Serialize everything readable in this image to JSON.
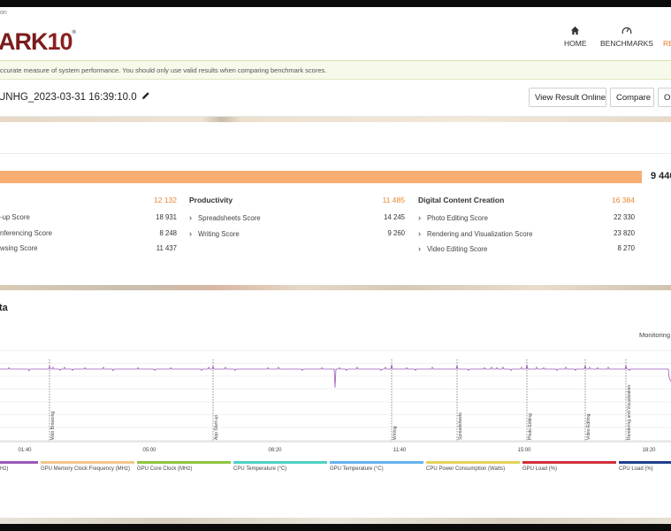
{
  "window": {
    "title_fragment": "on"
  },
  "header": {
    "logo_main": "ARK",
    "logo_num": "10",
    "logo_reg": "®",
    "nav": [
      {
        "label": "HOME",
        "icon": "home-icon"
      },
      {
        "label": "BENCHMARKS",
        "icon": "speedometer-icon"
      },
      {
        "label": "RE"
      }
    ]
  },
  "banner": {
    "text": "ccurate measure of system performance. You should only use valid results when comparing benchmark scores."
  },
  "result": {
    "name": "UNHG_2023-03-31 16:39:10.0",
    "buttons": {
      "view": "View Result Online",
      "compare": "Compare",
      "options": "Op"
    }
  },
  "scores": {
    "total": "9 440",
    "groups": [
      {
        "title": "",
        "value": "12 132",
        "rows": [
          {
            "label": "-up Score",
            "value": "18 931"
          },
          {
            "label": "nferencing Score",
            "value": "8 248"
          },
          {
            "label": "wsing Score",
            "value": "11 437"
          }
        ]
      },
      {
        "title": "Productivity",
        "value": "11 485",
        "rows": [
          {
            "label": "Spreadsheets Score",
            "value": "14 245"
          },
          {
            "label": "Writing Score",
            "value": "9 260"
          }
        ]
      },
      {
        "title": "Digital Content Creation",
        "value": "16 384",
        "rows": [
          {
            "label": "Photo Editing Score",
            "value": "22 330"
          },
          {
            "label": "Rendering and Visualization Score",
            "value": "23 820"
          },
          {
            "label": "Video Editing Score",
            "value": "8 270"
          }
        ]
      }
    ]
  },
  "monitoring": {
    "title": "ta",
    "right_label": "Monitoring",
    "time_ticks": [
      "01:40",
      "05:00",
      "08:20",
      "11:40",
      "15:00",
      "18:20"
    ],
    "markers": [
      "Web Browsing",
      "App Start-up",
      "Writing",
      "Spreadsheets",
      "Photo Editing",
      "Video Editing",
      "Rendering and Visualization"
    ],
    "legend": [
      {
        "label": "Hz)",
        "color": "#9b59b6"
      },
      {
        "label": "GPU Memory Clock Frequency (MHz)",
        "color": "#f2c68c"
      },
      {
        "label": "GPU Core Clock (MHz)",
        "color": "#8dc63f"
      },
      {
        "label": "CPU Temperature (°C)",
        "color": "#4fd1c5"
      },
      {
        "label": "GPU Temperature (°C)",
        "color": "#63b3ed"
      },
      {
        "label": "CPU Power Consumption (Watts)",
        "color": "#e4d35c"
      },
      {
        "label": "GPU Load (%)",
        "color": "#d32f3a"
      },
      {
        "label": "CPU Load (%)",
        "color": "#1f3f8f"
      }
    ],
    "line_color": "#9b59b6"
  }
}
